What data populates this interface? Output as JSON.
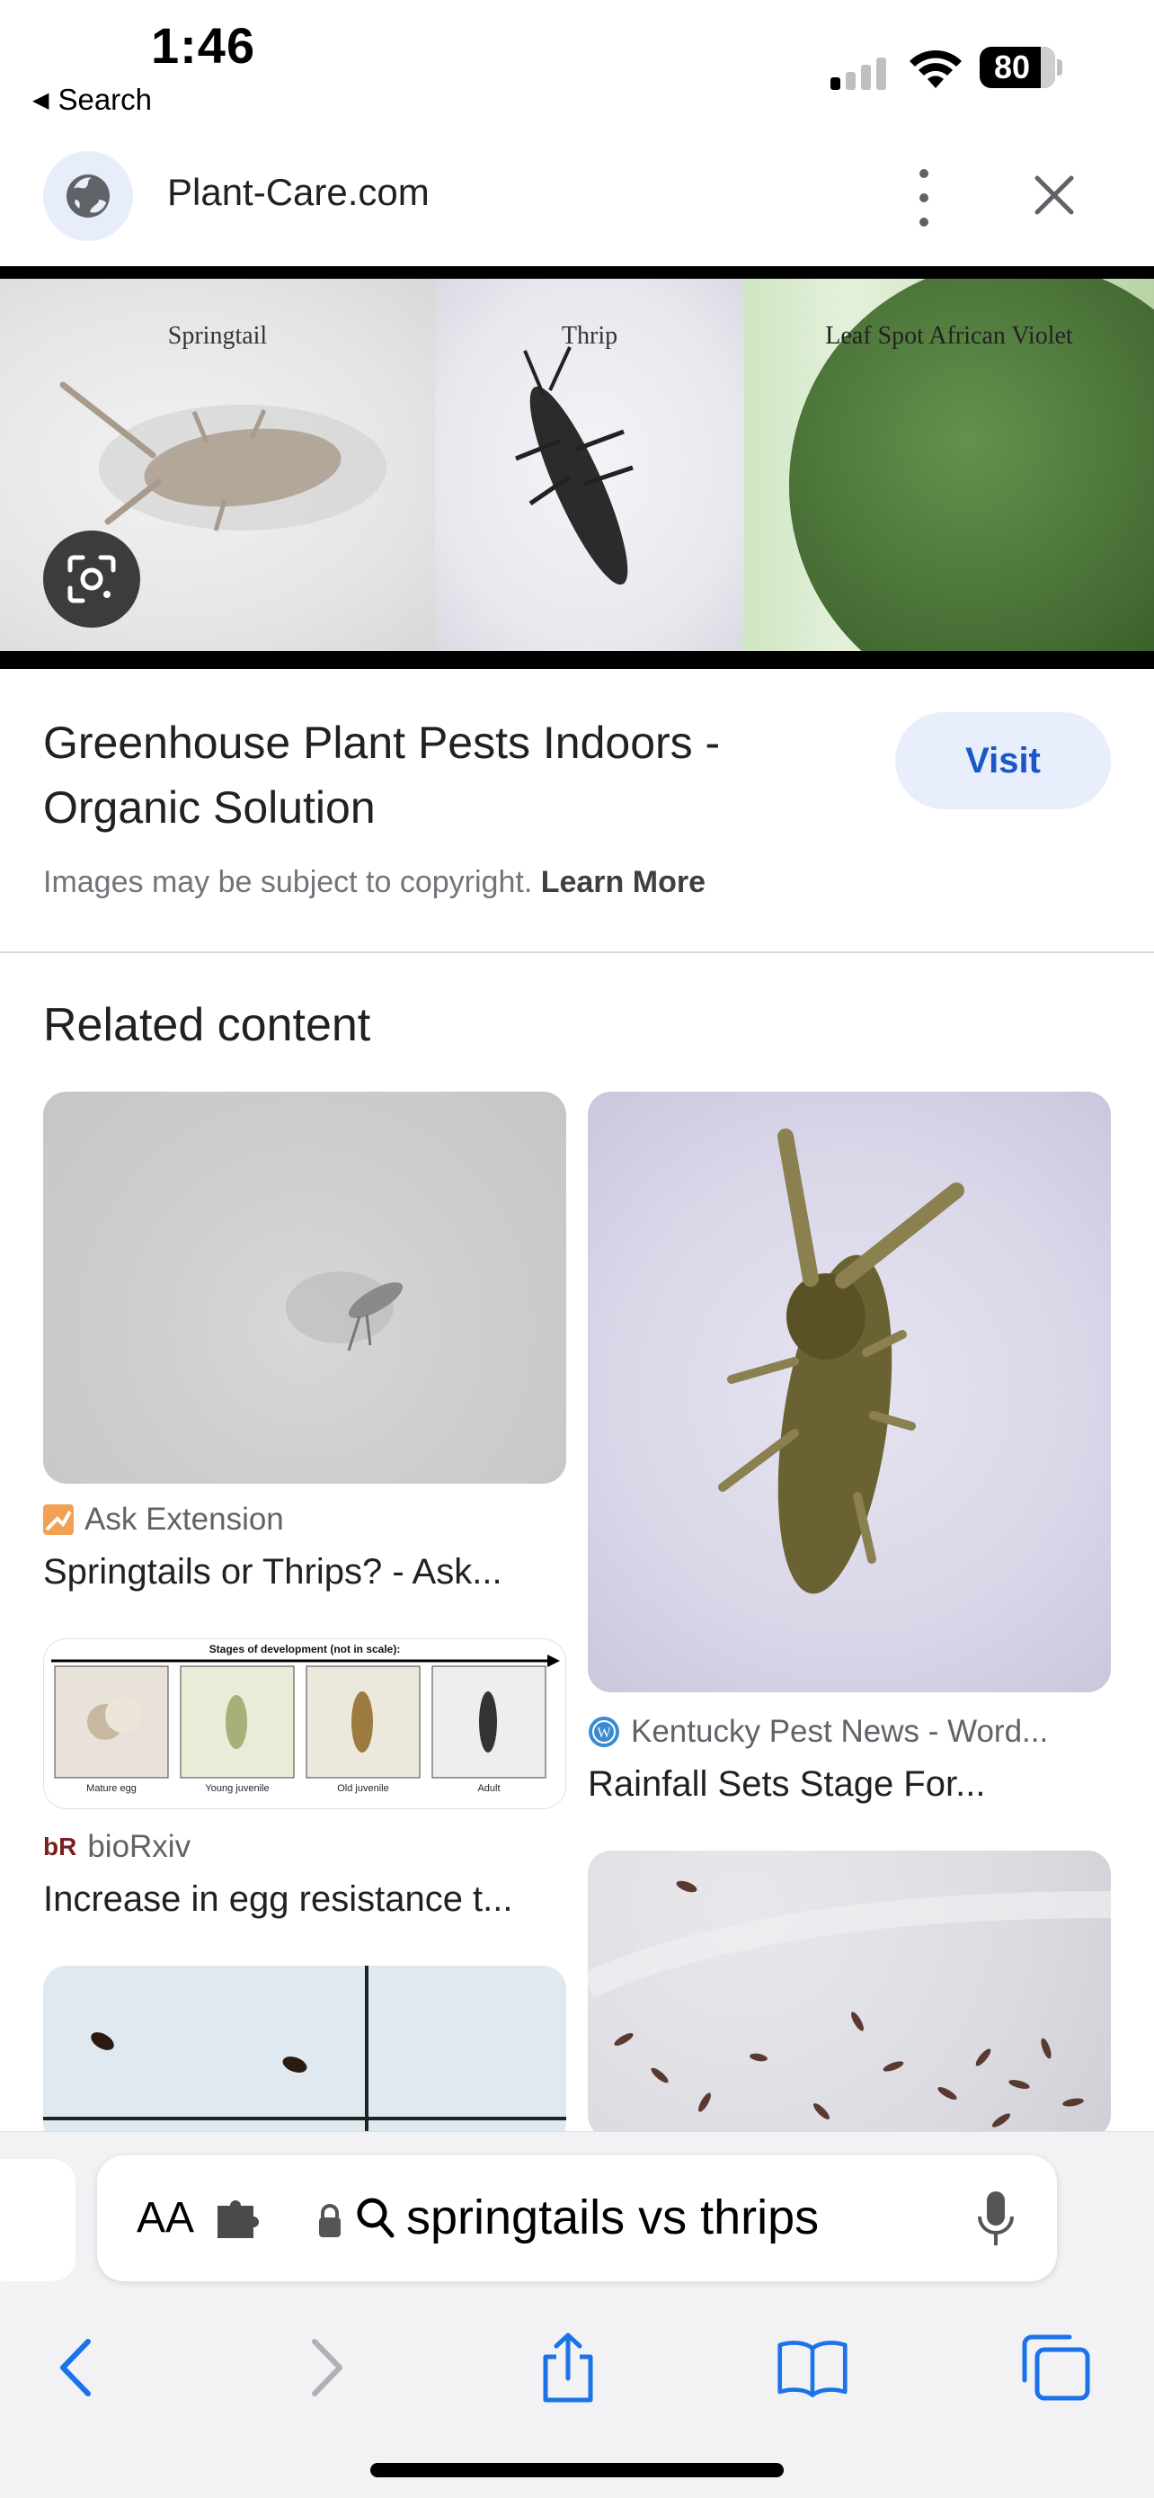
{
  "status_bar": {
    "time": "1:46",
    "back_label": "Search",
    "battery": "80"
  },
  "site": {
    "name": "Plant-Care.com"
  },
  "hero": {
    "labels": [
      "Springtail",
      "Thrip",
      "Leaf Spot African Violet"
    ]
  },
  "result": {
    "title": "Greenhouse Plant Pests Indoors - Organic Solution",
    "visit_label": "Visit",
    "copyright_text": "Images may be subject to copyright.",
    "learn_more": "Learn More"
  },
  "related": {
    "heading": "Related content",
    "items": [
      {
        "source": "Ask Extension",
        "caption": "Springtails or Thrips? - Ask..."
      },
      {
        "source": "Kentucky Pest News - Word...",
        "caption": "Rainfall Sets Stage For..."
      },
      {
        "source": "bioRxiv",
        "caption": "Increase in egg resistance t..."
      }
    ],
    "stages_chart": {
      "title": "Stages of development (not in scale):",
      "stages": [
        "Mature egg",
        "Young juvenile",
        "Old juvenile",
        "Adult"
      ]
    }
  },
  "address_bar": {
    "aa": "AA",
    "query": "springtails vs thrips"
  },
  "colors": {
    "accent": "#1a57c7",
    "visit_bg": "#e8eefb",
    "toolbar_icon": "#1a73e8"
  }
}
